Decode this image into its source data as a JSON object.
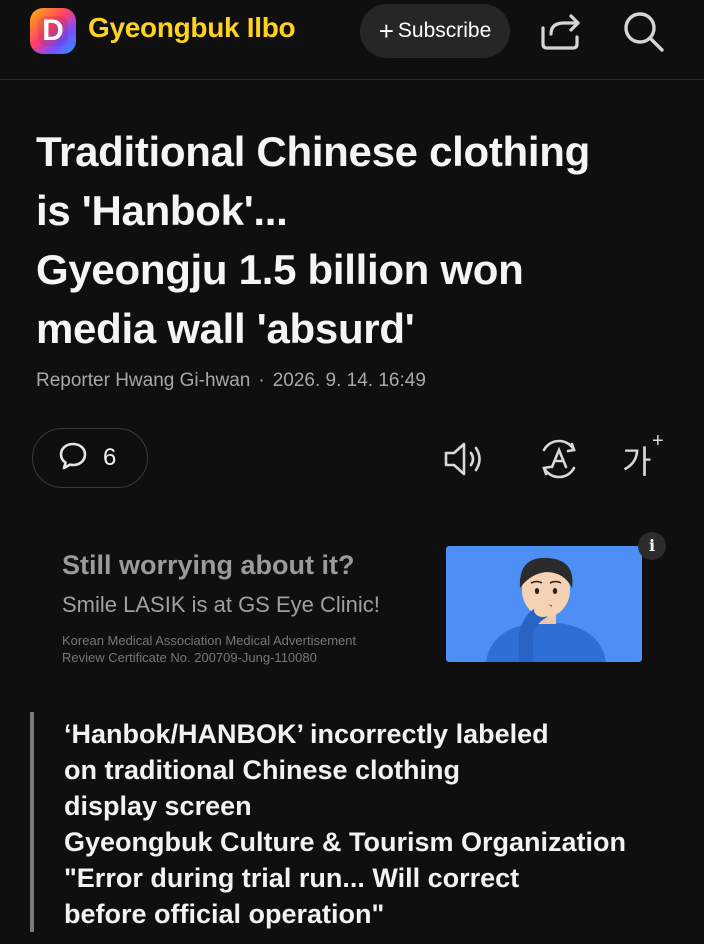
{
  "header": {
    "logo_letter": "D",
    "site_name": "Gyeongbuk Ilbo",
    "subscribe_label": "Subscribe",
    "icons": [
      "share-icon",
      "search-icon"
    ],
    "brand_color": "#ffd21f"
  },
  "article": {
    "headline_lines": [
      "Traditional Chinese clothing",
      "is 'Hanbok'...",
      "Gyeongju 1.5 billion won",
      "media wall 'absurd'"
    ],
    "reporter": "Reporter Hwang Gi-hwan",
    "separator": "·",
    "timestamp": "2026. 9. 14. 16:49"
  },
  "toolbar": {
    "comment_count": "6",
    "font_size_label": "가",
    "font_size_plus": "+",
    "icons": [
      "comment-icon",
      "speaker-icon",
      "translate-icon",
      "font-size-icon"
    ]
  },
  "ad": {
    "title": "Still worrying about it?",
    "subtitle": "Smile LASIK is at GS Eye Clinic!",
    "fine_print": [
      "Korean Medical Association Medical Advertisement",
      "Review Certificate No. 200709-Jung-110080"
    ],
    "info_label": "i"
  },
  "subheadline_lines": [
    "‘Hanbok/HANBOK’ incorrectly labeled",
    "on traditional Chinese clothing",
    "display screen",
    "Gyeongbuk Culture & Tourism Organization",
    "\"Error during trial run... Will correct",
    "before official operation\""
  ]
}
